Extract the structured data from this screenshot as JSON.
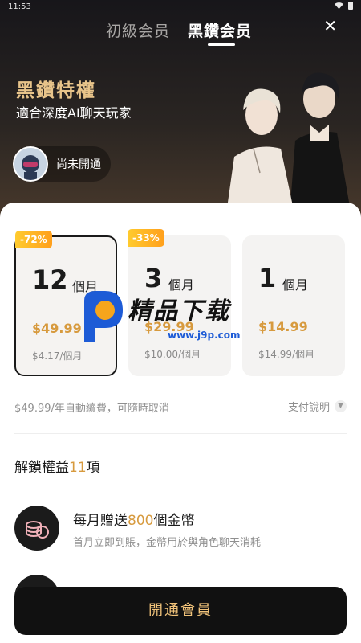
{
  "status_bar": {
    "time": "11:53"
  },
  "tabs": {
    "basic": "初級会员",
    "black": "黑鑽会员"
  },
  "hero": {
    "title": "黑鑽特權",
    "subtitle": "適合深度AI聊天玩家",
    "user_status": "尚未開通"
  },
  "plans": [
    {
      "badge": "-72%",
      "num": "12",
      "unit": "個月",
      "price": "$49.99",
      "per": "$4.17/個月"
    },
    {
      "badge": "-33%",
      "num": "3",
      "unit": "個月",
      "price": "$29.99",
      "per": "$10.00/個月"
    },
    {
      "badge": "",
      "num": "1",
      "unit": "個月",
      "price": "$14.99",
      "per": "$14.99/個月"
    }
  ],
  "renew_note": "$49.99/年自動續費，可隨時取消",
  "pay_help": "支付說明",
  "benefits": {
    "title_prefix": "解鎖權益",
    "count": "11",
    "title_suffix": "項",
    "item": {
      "title_prefix": "每月贈送",
      "highlight": "800",
      "title_suffix": "個金幣",
      "desc": "首月立即到賬，金幣用於與角色聊天消耗"
    }
  },
  "cta": "開通會員",
  "watermark": {
    "brand": "精品下载",
    "url": "www.j9p.com"
  },
  "colors": {
    "accent_gold": "#d79a3e",
    "badge_orange": "#ff9f1c",
    "cta_text": "#f1c37a"
  }
}
